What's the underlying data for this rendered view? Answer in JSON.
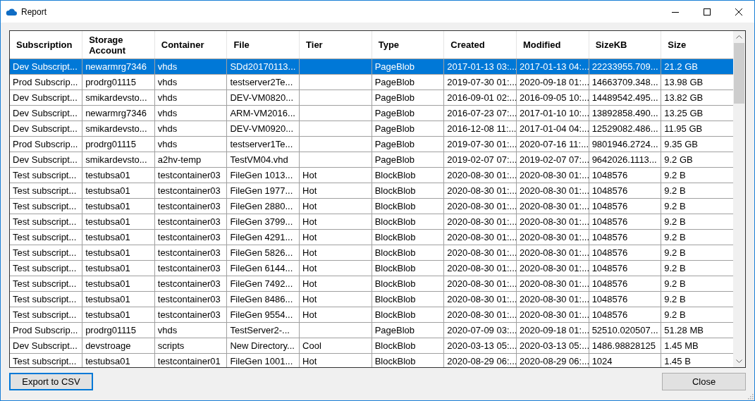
{
  "window": {
    "title": "Report"
  },
  "table": {
    "columns": [
      "Subscription",
      "Storage Account",
      "Container",
      "File",
      "Tier",
      "Type",
      "Created",
      "Modified",
      "SizeKB",
      "Size"
    ],
    "rows": [
      {
        "selected": true,
        "cells": [
          "Dev Subscript...",
          "newarmrg7346",
          "vhds",
          "SDd20170113...",
          "",
          "PageBlob",
          "2017-01-13 03:...",
          "2017-01-13 04:...",
          "22233955.709...",
          "21.2 GB"
        ]
      },
      {
        "selected": false,
        "cells": [
          "Prod Subscrip...",
          "prodrg01115",
          "vhds",
          "testserver2Te...",
          "",
          "PageBlob",
          "2019-07-30 01:...",
          "2020-09-18 01:...",
          "14663709.348...",
          "13.98 GB"
        ]
      },
      {
        "selected": false,
        "cells": [
          "Dev Subscript...",
          "smikardevsto...",
          "vhds",
          "DEV-VM0820...",
          "",
          "PageBlob",
          "2016-09-01 02:...",
          "2016-09-05 10:...",
          "14489542.495...",
          "13.82 GB"
        ]
      },
      {
        "selected": false,
        "cells": [
          "Dev Subscript...",
          "newarmrg7346",
          "vhds",
          "ARM-VM2016...",
          "",
          "PageBlob",
          "2016-07-23 07:...",
          "2017-01-10 10:...",
          "13892858.490...",
          "13.25 GB"
        ]
      },
      {
        "selected": false,
        "cells": [
          "Dev Subscript...",
          "smikardevsto...",
          "vhds",
          "DEV-VM0920...",
          "",
          "PageBlob",
          "2016-12-08 11:...",
          "2017-01-04 04:...",
          "12529082.486...",
          "11.95 GB"
        ]
      },
      {
        "selected": false,
        "cells": [
          "Prod Subscrip...",
          "prodrg01115",
          "vhds",
          "testserver1Te...",
          "",
          "PageBlob",
          "2019-07-30 01:...",
          "2020-07-16 11:...",
          "9801946.2724...",
          "9.35 GB"
        ]
      },
      {
        "selected": false,
        "cells": [
          "Dev Subscript...",
          "smikardevsto...",
          "a2hv-temp",
          "TestVM04.vhd",
          "",
          "PageBlob",
          "2019-02-07 07:...",
          "2019-02-07 07:...",
          "9642026.1113...",
          "9.2 GB"
        ]
      },
      {
        "selected": false,
        "cells": [
          "Test subscript...",
          "testubsa01",
          "testcontainer03",
          "FileGen 1013...",
          "Hot",
          "BlockBlob",
          "2020-08-30 01:...",
          "2020-08-30 01:...",
          "1048576",
          "9.2 B"
        ]
      },
      {
        "selected": false,
        "cells": [
          "Test subscript...",
          "testubsa01",
          "testcontainer03",
          "FileGen 1977...",
          "Hot",
          "BlockBlob",
          "2020-08-30 01:...",
          "2020-08-30 01:...",
          "1048576",
          "9.2 B"
        ]
      },
      {
        "selected": false,
        "cells": [
          "Test subscript...",
          "testubsa01",
          "testcontainer03",
          "FileGen 2880...",
          "Hot",
          "BlockBlob",
          "2020-08-30 01:...",
          "2020-08-30 01:...",
          "1048576",
          "9.2 B"
        ]
      },
      {
        "selected": false,
        "cells": [
          "Test subscript...",
          "testubsa01",
          "testcontainer03",
          "FileGen 3799...",
          "Hot",
          "BlockBlob",
          "2020-08-30 01:...",
          "2020-08-30 01:...",
          "1048576",
          "9.2 B"
        ]
      },
      {
        "selected": false,
        "cells": [
          "Test subscript...",
          "testubsa01",
          "testcontainer03",
          "FileGen 4291...",
          "Hot",
          "BlockBlob",
          "2020-08-30 01:...",
          "2020-08-30 01:...",
          "1048576",
          "9.2 B"
        ]
      },
      {
        "selected": false,
        "cells": [
          "Test subscript...",
          "testubsa01",
          "testcontainer03",
          "FileGen 5826...",
          "Hot",
          "BlockBlob",
          "2020-08-30 01:...",
          "2020-08-30 01:...",
          "1048576",
          "9.2 B"
        ]
      },
      {
        "selected": false,
        "cells": [
          "Test subscript...",
          "testubsa01",
          "testcontainer03",
          "FileGen 6144...",
          "Hot",
          "BlockBlob",
          "2020-08-30 01:...",
          "2020-08-30 01:...",
          "1048576",
          "9.2 B"
        ]
      },
      {
        "selected": false,
        "cells": [
          "Test subscript...",
          "testubsa01",
          "testcontainer03",
          "FileGen 7492...",
          "Hot",
          "BlockBlob",
          "2020-08-30 01:...",
          "2020-08-30 01:...",
          "1048576",
          "9.2 B"
        ]
      },
      {
        "selected": false,
        "cells": [
          "Test subscript...",
          "testubsa01",
          "testcontainer03",
          "FileGen 8486...",
          "Hot",
          "BlockBlob",
          "2020-08-30 01:...",
          "2020-08-30 01:...",
          "1048576",
          "9.2 B"
        ]
      },
      {
        "selected": false,
        "cells": [
          "Test subscript...",
          "testubsa01",
          "testcontainer03",
          "FileGen 9554...",
          "Hot",
          "BlockBlob",
          "2020-08-30 01:...",
          "2020-08-30 01:...",
          "1048576",
          "9.2 B"
        ]
      },
      {
        "selected": false,
        "cells": [
          "Prod Subscrip...",
          "prodrg01115",
          "vhds",
          "TestServer2-...",
          "",
          "PageBlob",
          "2020-07-09 03:...",
          "2020-09-18 01:...",
          "52510.020507...",
          "51.28 MB"
        ]
      },
      {
        "selected": false,
        "cells": [
          "Dev Subscript...",
          "devstroage",
          "scripts",
          "New Directory...",
          "Cool",
          "BlockBlob",
          "2020-03-13 05:...",
          "2020-03-13 05:...",
          "1486.98828125",
          "1.45 MB"
        ]
      },
      {
        "selected": false,
        "cells": [
          "Test subscript...",
          "testubsa01",
          "testcontainer01",
          "FileGen 1001...",
          "Hot",
          "BlockBlob",
          "2020-08-29 06:...",
          "2020-08-29 06:...",
          "1024",
          "1.45 B"
        ]
      }
    ]
  },
  "buttons": [
    {
      "label": "Export to CSV",
      "focused": true
    },
    {
      "label": "Close",
      "focused": false
    }
  ]
}
